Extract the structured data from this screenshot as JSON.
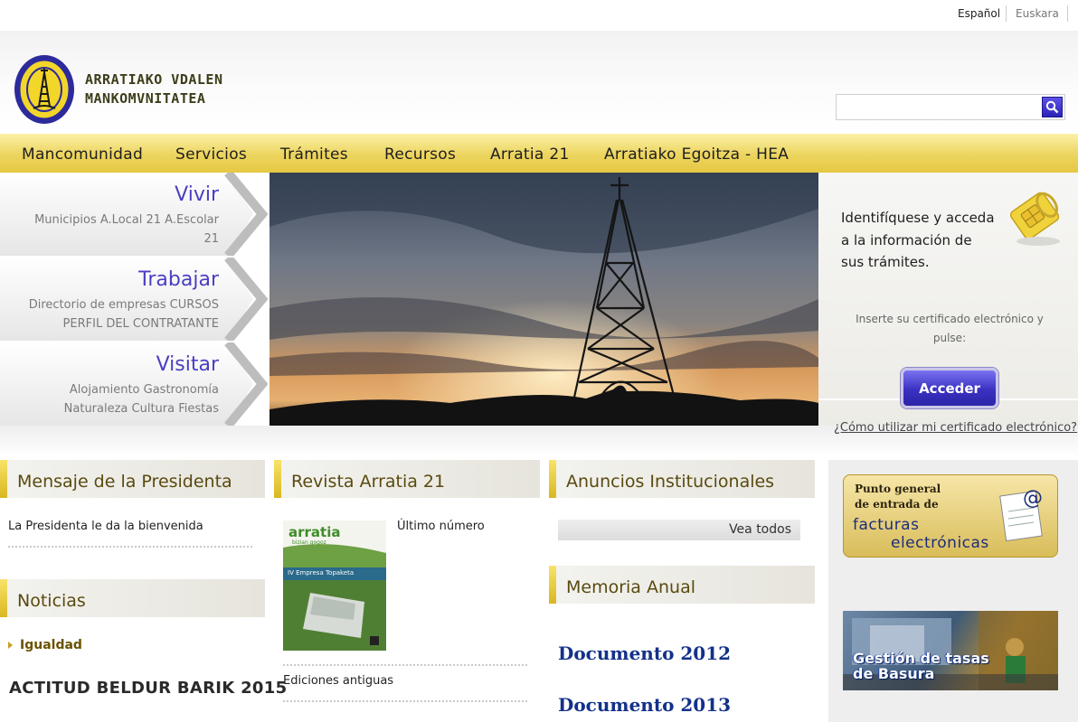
{
  "lang": {
    "es": "Español",
    "eu": "Euskara"
  },
  "header": {
    "logo_text_line1": "ARRATIAKO VDALEN",
    "logo_text_line2": "MANKOMVNITATEA",
    "search_placeholder": ""
  },
  "nav": [
    "Mancomunidad",
    "Servicios",
    "Trámites",
    "Recursos",
    "Arratia 21",
    "Arratiako Egoitza - HEA"
  ],
  "side": {
    "vivir": {
      "title": "Vivir",
      "links_line1": "Municipios  A.Local 21  A.Escolar",
      "links_line2": "21"
    },
    "trabajar": {
      "title": "Trabajar",
      "links_line1": "Directorio de empresas  CURSOS",
      "links_line2": "PERFIL DEL CONTRATANTE"
    },
    "visitar": {
      "title": "Visitar",
      "links_line1": "Alojamiento  Gastronomía",
      "links_line2": "Naturaleza  Cultura  Fiestas"
    }
  },
  "login": {
    "text": "Identifíquese y acceda a la información de sus trámites.",
    "sub": "Inserte su certificado electrónico y pulse:",
    "button": "Acceder",
    "cert_link": "¿Cómo utilizar mi certificado electrónico?"
  },
  "sections": {
    "presidenta": {
      "title": "Mensaje de la Presidenta",
      "text": "La Presidenta le da la bienvenida"
    },
    "noticias": {
      "title": "Noticias",
      "item": "Igualdad",
      "headline": "ACTITUD BELDUR BARIK 2015"
    },
    "revista": {
      "title": "Revista Arratia 21",
      "ultimo": "Último número",
      "antiguas": "Ediciones antiguas",
      "cover_title": "arratia",
      "cover_sub": "bizian gogoz",
      "cover_band": "IV Empresa Topaketa"
    },
    "anuncios": {
      "title": "Anuncios Institucionales",
      "vea": "Vea todos"
    },
    "memoria": {
      "title": "Memoria Anual",
      "docs": [
        "Documento 2012",
        "Documento 2013"
      ]
    }
  },
  "banners": {
    "facturas_top_1": "Punto general",
    "facturas_top_2": "de entrada de",
    "facturas_main_1": "facturas",
    "facturas_main_2": "electrónicas",
    "basura_1": "Gestión de tasas",
    "basura_2": "de Basura"
  },
  "colors": {
    "nav_yellow": "#ecd45e",
    "accent_blue": "#4a3fc3",
    "doc_blue": "#13318a"
  }
}
